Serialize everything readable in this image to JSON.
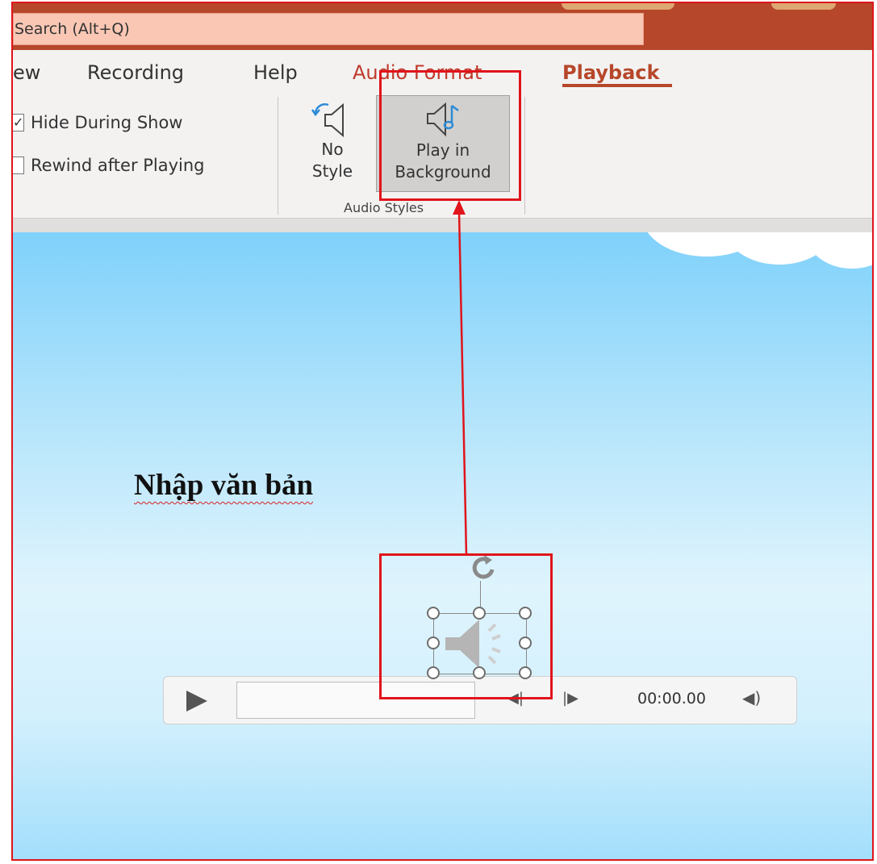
{
  "search": {
    "text": "Search (Alt+Q)"
  },
  "tabs": [
    {
      "label": "ew"
    },
    {
      "label": "Recording"
    },
    {
      "label": "Help"
    },
    {
      "label": "Audio Format"
    },
    {
      "label": "Playback"
    }
  ],
  "ribbon": {
    "hide_during_show": "Hide During Show",
    "rewind_after_playing": "Rewind after Playing",
    "no_style_line1": "No",
    "no_style_line2": "Style",
    "play_bg_line1": "Play in",
    "play_bg_line2": "Background",
    "group_label": "Audio Styles"
  },
  "slide": {
    "text": "Nhập văn bản"
  },
  "player": {
    "time": "00:00.00"
  },
  "colors": {
    "accent": "#b7472a",
    "annotation": "#e0141b"
  },
  "icons": [
    "no-style-icon",
    "play-in-background-icon",
    "rotate-handle-icon",
    "speaker-icon",
    "play-icon",
    "skip-back-icon",
    "skip-forward-icon",
    "volume-icon"
  ]
}
